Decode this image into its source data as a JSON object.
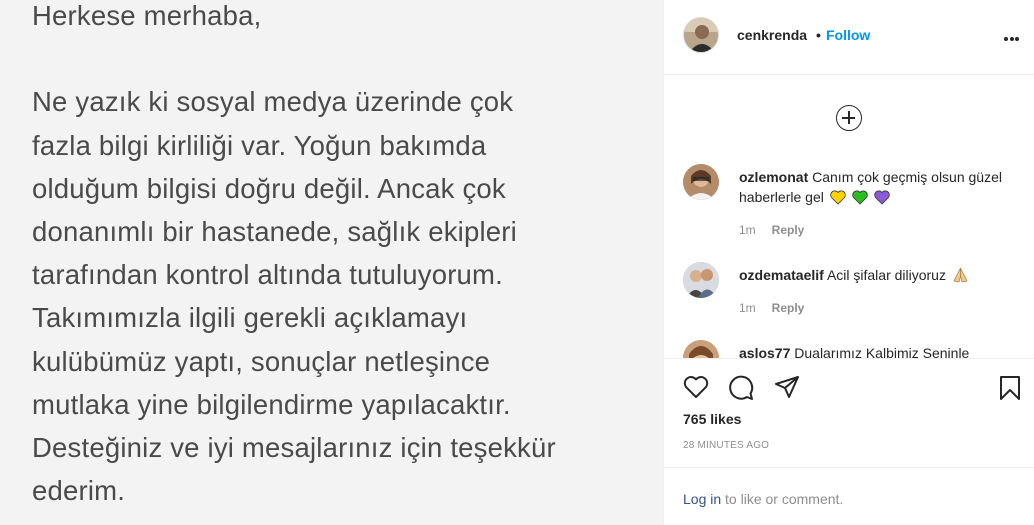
{
  "photo": {
    "lines": [
      "Herkese merhaba,",
      "",
      "Ne yazık ki sosyal medya üzerinde çok",
      "fazla bilgi kirliliği var. Yoğun bakımda",
      "olduğum bilgisi doğru değil. Ancak çok",
      "donanımlı bir hastanede, sağlık ekipleri",
      "tarafından kontrol altında tutuluyorum.",
      "Takımımızla ilgili gerekli açıklamayı",
      "kulübümüz yaptı, sonuçlar netleşince",
      "mutlaka yine bilgilendirme yapılacaktır.",
      "Desteğiniz ve iyi mesajlarınız için teşekkür",
      "ederim."
    ]
  },
  "header": {
    "username": "cenkrenda",
    "separator": "•",
    "follow_label": "Follow",
    "more_icon": "more-horizontal-icon"
  },
  "add_icon": "plus-circle-icon",
  "comments": [
    {
      "username": "ozlemonat",
      "text": "Canım çok geçmiş olsun güzel haberlerle gel",
      "emoji": [
        "yellow-heart",
        "green-heart",
        "purple-heart"
      ],
      "emoji_colors": [
        "#ffcc00",
        "#2bbd22",
        "#8a5bd6"
      ],
      "time": "1m",
      "reply_label": "Reply"
    },
    {
      "username": "ozdemataelif",
      "text": "Acil şifalar diliyoruz",
      "emoji": [
        "folded-hands"
      ],
      "time": "1m",
      "reply_label": "Reply"
    },
    {
      "username": "aslos77",
      "text": "Dualarımız Kalbimiz Seninle"
    }
  ],
  "actions": {
    "like_icon": "heart-icon",
    "comment_icon": "comment-icon",
    "share_icon": "share-icon",
    "save_icon": "bookmark-icon"
  },
  "likes_label": "765 likes",
  "time_label": "28 MINUTES AGO",
  "login": {
    "link_label": "Log in",
    "suffix": " to like or comment."
  }
}
